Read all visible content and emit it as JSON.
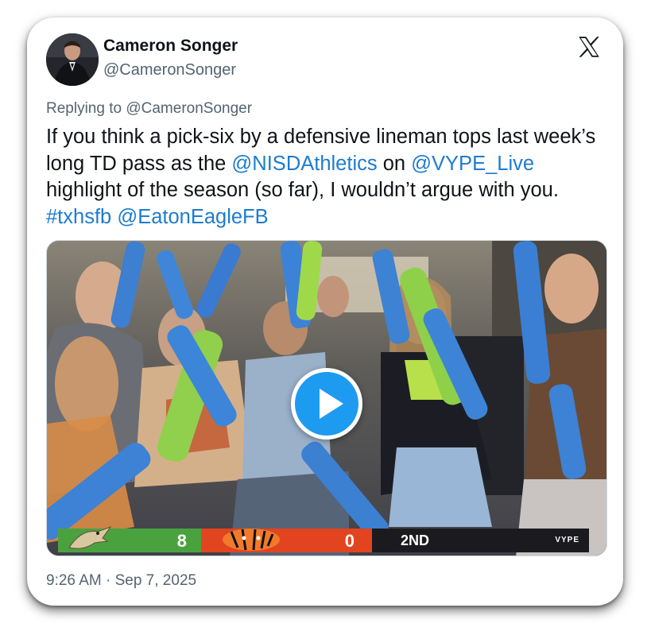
{
  "tweet": {
    "display_name": "Cameron Songer",
    "handle": "@CameronSonger",
    "reply_prefix": "Replying to",
    "reply_handle": "@CameronSonger",
    "text_parts": {
      "p1": "If you think a pick-six by a defensive lineman tops last week’s long TD pass as the ",
      "m1": "@NISDAthletics",
      "p2": " on ",
      "m2": "@VYPE_Live",
      "p3": " highlight of the season (so far), I wouldn’t argue with you. ",
      "h1": "#txhsfb",
      "p4": " ",
      "m3": "@EatonEagleFB"
    },
    "timestamp": "9:26 AM · Sep 7, 2025"
  },
  "video": {
    "scoreboard": {
      "home_score": "8",
      "away_score": "0",
      "period": "2ND",
      "brand": "VYPE"
    }
  },
  "colors": {
    "link": "#1d7ccf",
    "play_button": "#1d9bf0",
    "home_team": "#4aa23f",
    "away_team": "#e2441f"
  },
  "icons": [
    "x-logo-icon",
    "play-icon"
  ]
}
